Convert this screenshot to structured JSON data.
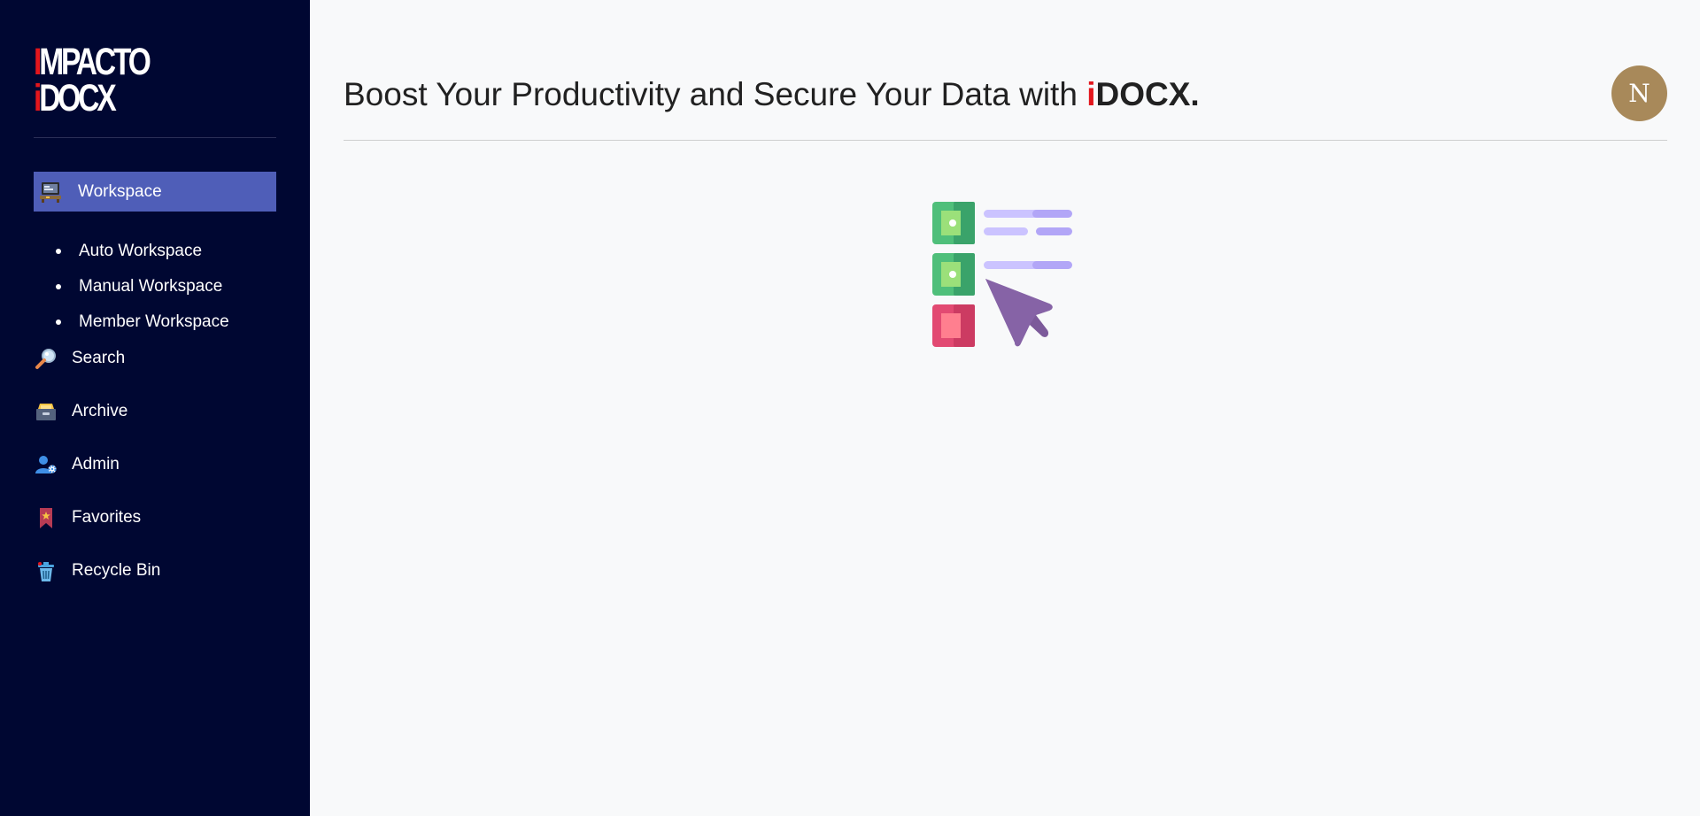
{
  "app": {
    "logo_line1": "IMPACTO",
    "logo_line2": "iDOCX"
  },
  "sidebar": {
    "items": [
      {
        "label": "Workspace",
        "icon": "workspace-icon",
        "active": true
      },
      {
        "label": "Search",
        "icon": "search-icon"
      },
      {
        "label": "Archive",
        "icon": "archive-icon"
      },
      {
        "label": "Admin",
        "icon": "admin-user-gear-icon"
      },
      {
        "label": "Favorites",
        "icon": "bookmark-star-icon"
      },
      {
        "label": "Recycle Bin",
        "icon": "recycle-bin-icon"
      }
    ],
    "workspace_subitems": [
      {
        "label": "Auto Workspace"
      },
      {
        "label": "Manual Workspace"
      },
      {
        "label": "Member Workspace"
      }
    ]
  },
  "header": {
    "title_prefix": "Boost Your Productivity and Secure Your Data with ",
    "brand_i": "i",
    "brand_rest": "DOCX."
  },
  "user": {
    "avatar_initial": "N"
  },
  "colors": {
    "sidebar_bg": "#000732",
    "active_item_bg": "#4f5eb8",
    "brand_red": "#e3161c",
    "avatar_bg": "#a8895a",
    "main_bg": "#f8f9fa"
  },
  "illustration": {
    "icon": "checklist-select-illustration-icon"
  }
}
